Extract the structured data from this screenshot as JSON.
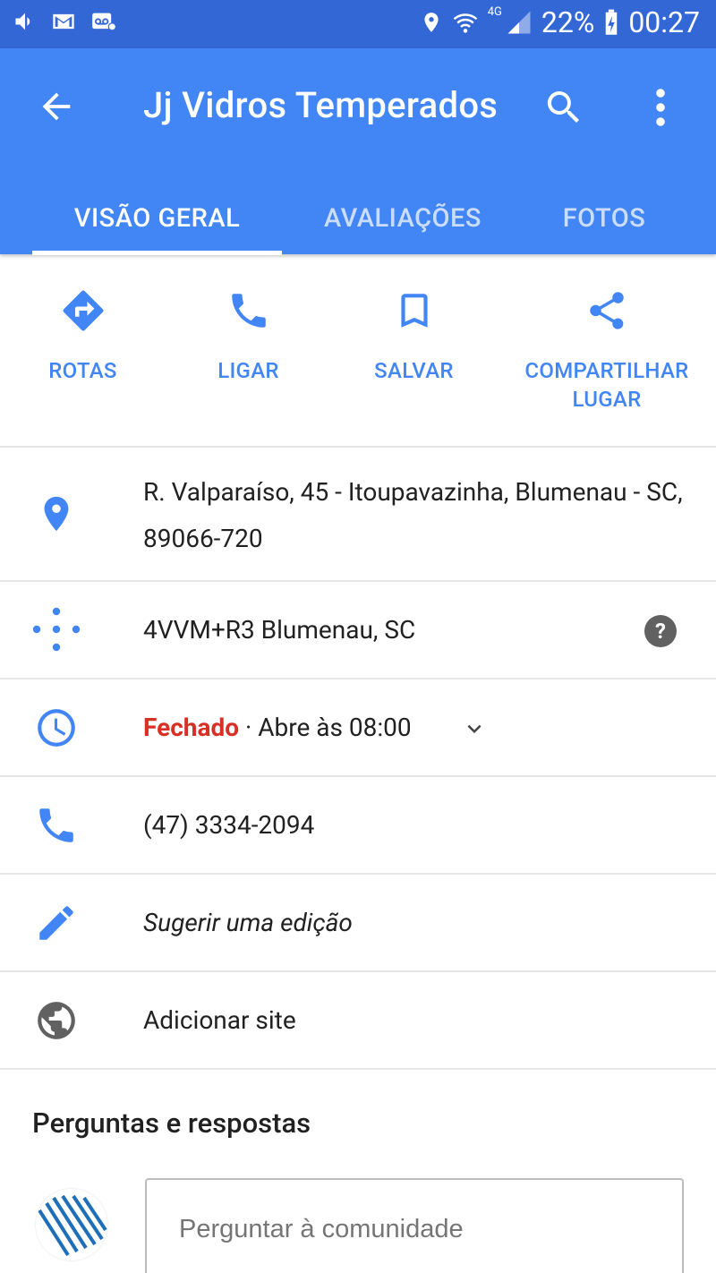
{
  "status_bar": {
    "network": "4G",
    "battery": "22%",
    "time": "00:27"
  },
  "app_bar": {
    "title": "Jj Vidros Temperados"
  },
  "tabs": [
    {
      "label": "VISÃO GERAL",
      "active": true
    },
    {
      "label": "AVALIAÇÕES",
      "active": false
    },
    {
      "label": "FOTOS",
      "active": false
    }
  ],
  "actions": [
    {
      "label": "ROTAS",
      "icon": "directions-icon"
    },
    {
      "label": "LIGAR",
      "icon": "phone-icon"
    },
    {
      "label": "SALVAR",
      "icon": "bookmark-icon"
    },
    {
      "label": "COMPARTILHAR LUGAR",
      "icon": "share-icon"
    }
  ],
  "info": {
    "address": "R. Valparaíso, 45 - Itoupavazinha, Blumenau - SC, 89066-720",
    "plus_code": "4VVM+R3 Blumenau, SC",
    "hours_status": "Fechado",
    "hours_detail": " · Abre às 08:00",
    "phone": "(47) 3334-2094",
    "suggest_edit": "Sugerir uma edição",
    "add_site": "Adicionar site"
  },
  "qa": {
    "title": "Perguntas e respostas",
    "input_placeholder": "Perguntar à comunidade"
  },
  "colors": {
    "status_bar": "#3367d6",
    "app_bar": "#4285f4",
    "accent": "#4285f4",
    "closed": "#d93025"
  }
}
